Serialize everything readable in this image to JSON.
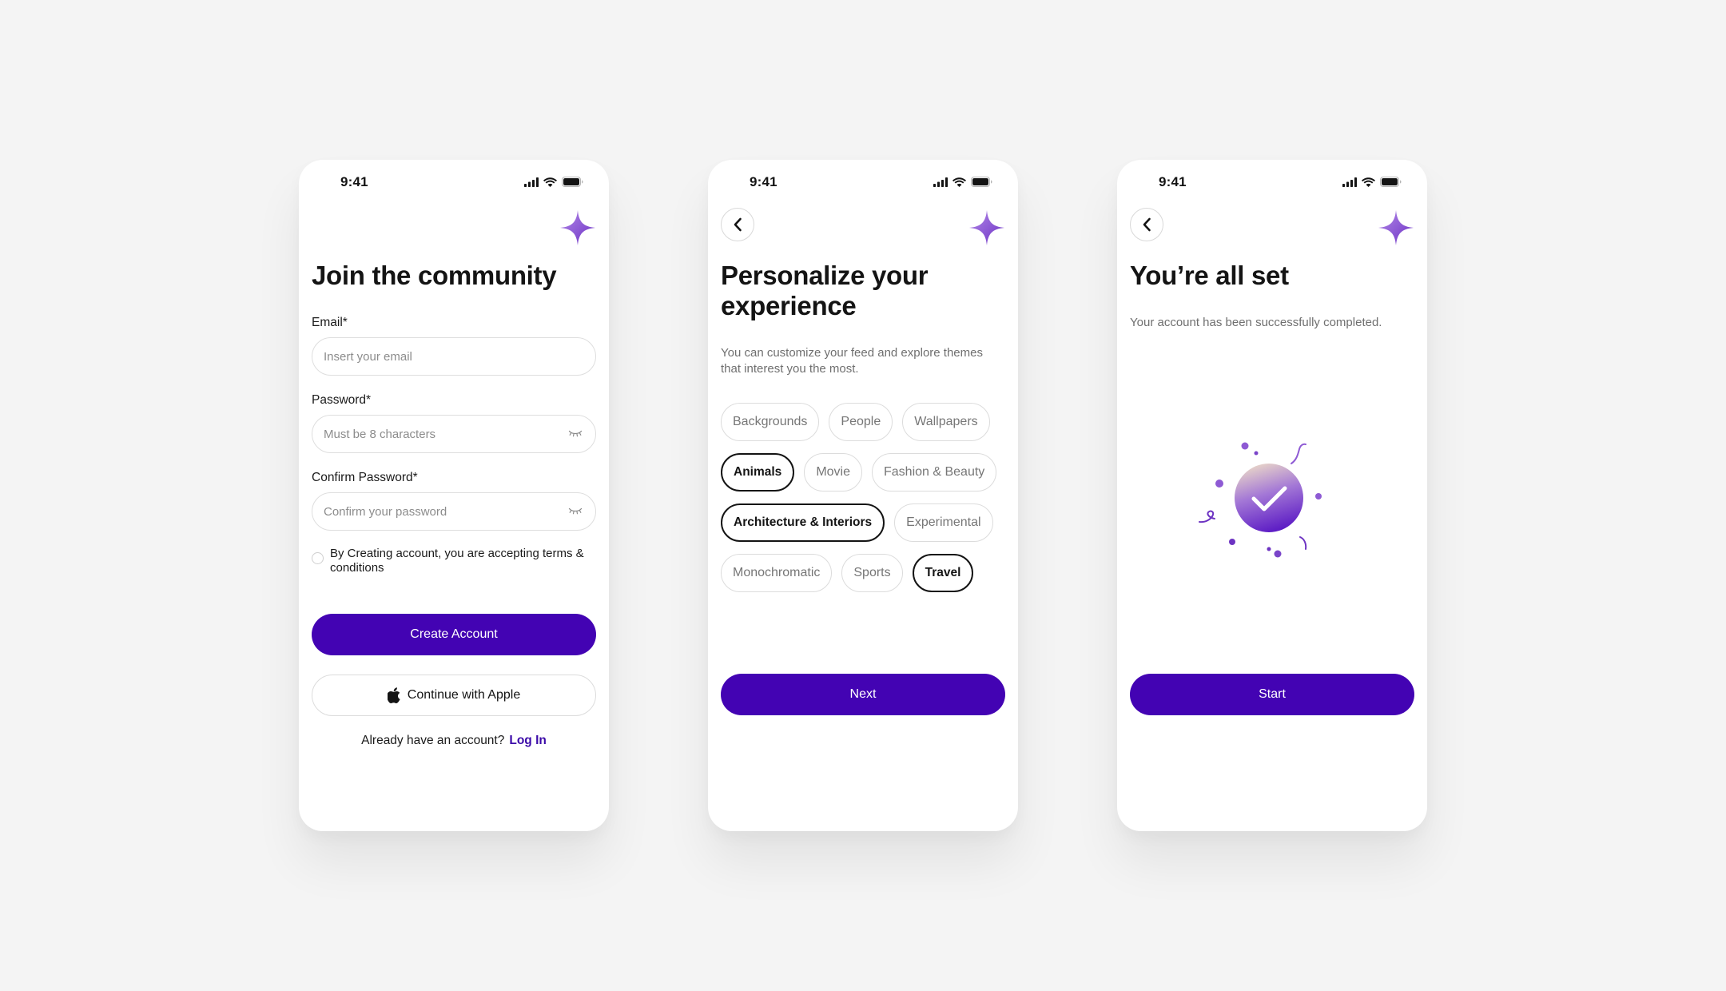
{
  "status_time": "9:41",
  "colors": {
    "primary": "#4303b3",
    "accent_purple": "#8a5cd6",
    "text": "#141414",
    "muted": "#6f6f6f",
    "border": "#dcdcdc",
    "background": "#f4f4f4"
  },
  "icons": {
    "signal": "signal-icon",
    "wifi": "wifi-icon",
    "battery": "battery-icon",
    "sparkle": "sparkle-icon",
    "back": "chevron-left-icon",
    "eye": "eye-closed-icon",
    "apple": "apple-icon",
    "check": "check-icon"
  },
  "signup": {
    "title": "Join the community",
    "email_label": "Email*",
    "email_placeholder": "Insert your email",
    "password_label": "Password*",
    "password_placeholder": "Must be 8 characters",
    "confirm_label": "Confirm Password*",
    "confirm_placeholder": "Confirm your password",
    "terms_text": "By Creating account, you are accepting terms & conditions",
    "create_button": "Create Account",
    "apple_button": "Continue with Apple",
    "have_account": "Already have an account?",
    "login_link": "Log In"
  },
  "personalize": {
    "title": "Personalize your experience",
    "subtitle": "You can customize your feed and explore themes that interest you the most.",
    "chip_rows": [
      [
        {
          "label": "Backgrounds",
          "selected": false
        },
        {
          "label": "People",
          "selected": false
        },
        {
          "label": "Wallpapers",
          "selected": false
        }
      ],
      [
        {
          "label": "Animals",
          "selected": true
        },
        {
          "label": "Movie",
          "selected": false
        },
        {
          "label": "Fashion & Beauty",
          "selected": false
        }
      ],
      [
        {
          "label": "Architecture & Interiors",
          "selected": true
        },
        {
          "label": "Experimental",
          "selected": false
        }
      ],
      [
        {
          "label": "Monochromatic",
          "selected": false
        },
        {
          "label": "Sports",
          "selected": false
        },
        {
          "label": "Travel",
          "selected": true
        }
      ]
    ],
    "next_button": "Next"
  },
  "success": {
    "title": "You’re all set",
    "subtitle": "Your account has been successfully completed.",
    "start_button": "Start"
  }
}
